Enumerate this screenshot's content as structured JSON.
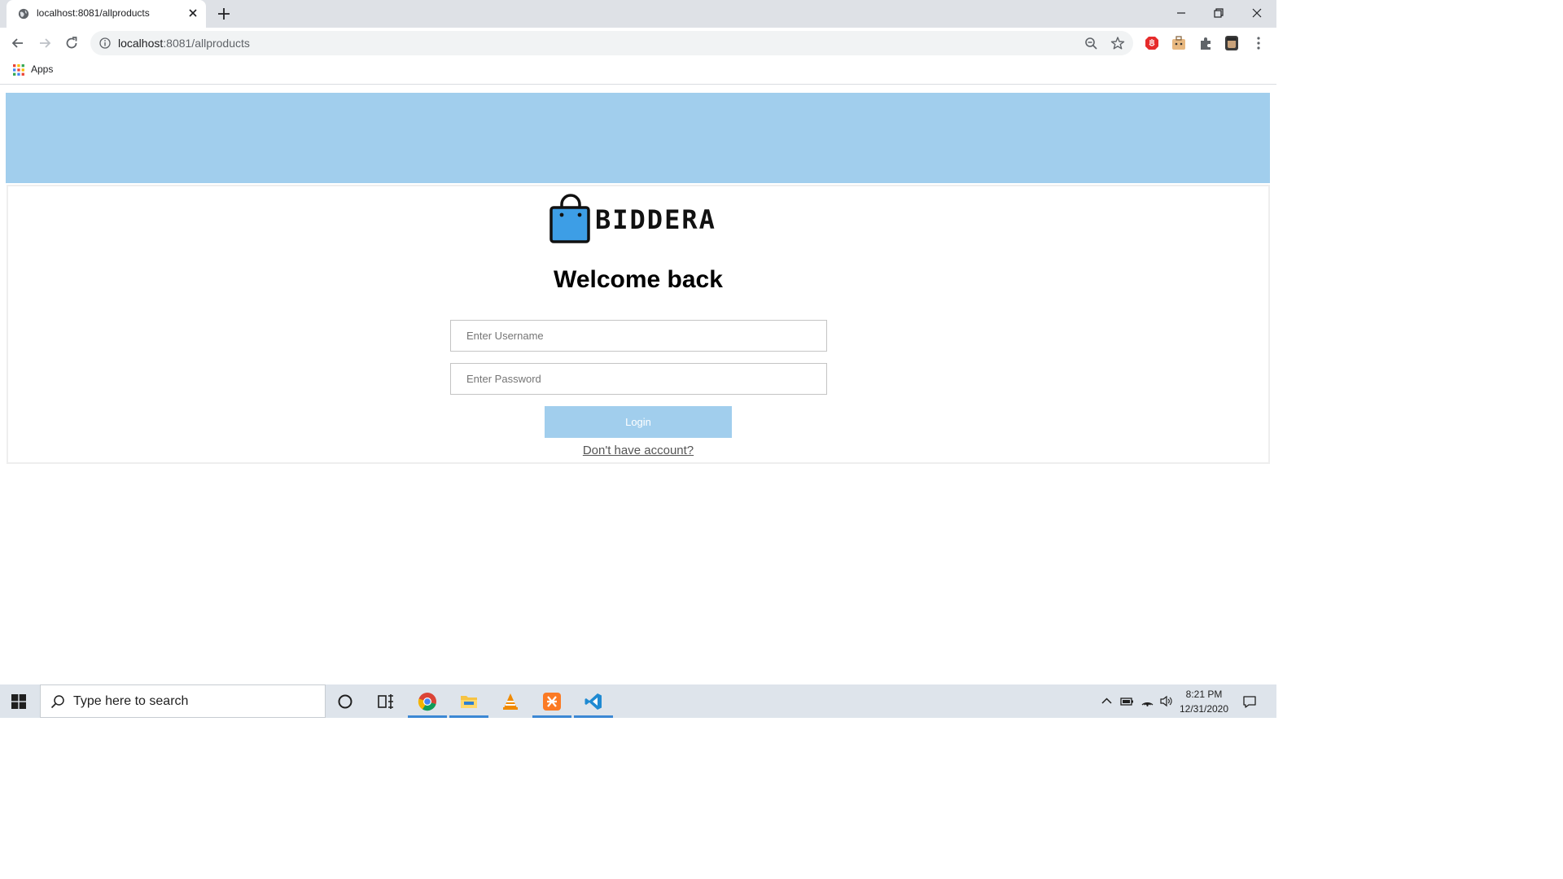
{
  "browser": {
    "tab_title": "localhost:8081/allproducts",
    "url_host": "localhost",
    "url_rest": ":8081/allproducts",
    "bookmarks": {
      "apps_label": "Apps"
    }
  },
  "page": {
    "brand": "BIDDERA",
    "heading": "Welcome back",
    "username_placeholder": "Enter Username",
    "password_placeholder": "Enter Password",
    "login_label": "Login",
    "signup_link": "Don't have account?",
    "colors": {
      "accent": "#a1ceed",
      "logo_bag": "#3d9ee6"
    }
  },
  "taskbar": {
    "search_placeholder": "Type here to search",
    "time": "8:21 PM",
    "date": "12/31/2020",
    "pinned_apps": [
      "cortana-icon",
      "task-view-icon",
      "chrome-icon",
      "file-explorer-icon",
      "vlc-icon",
      "xampp-icon",
      "vscode-icon"
    ]
  }
}
